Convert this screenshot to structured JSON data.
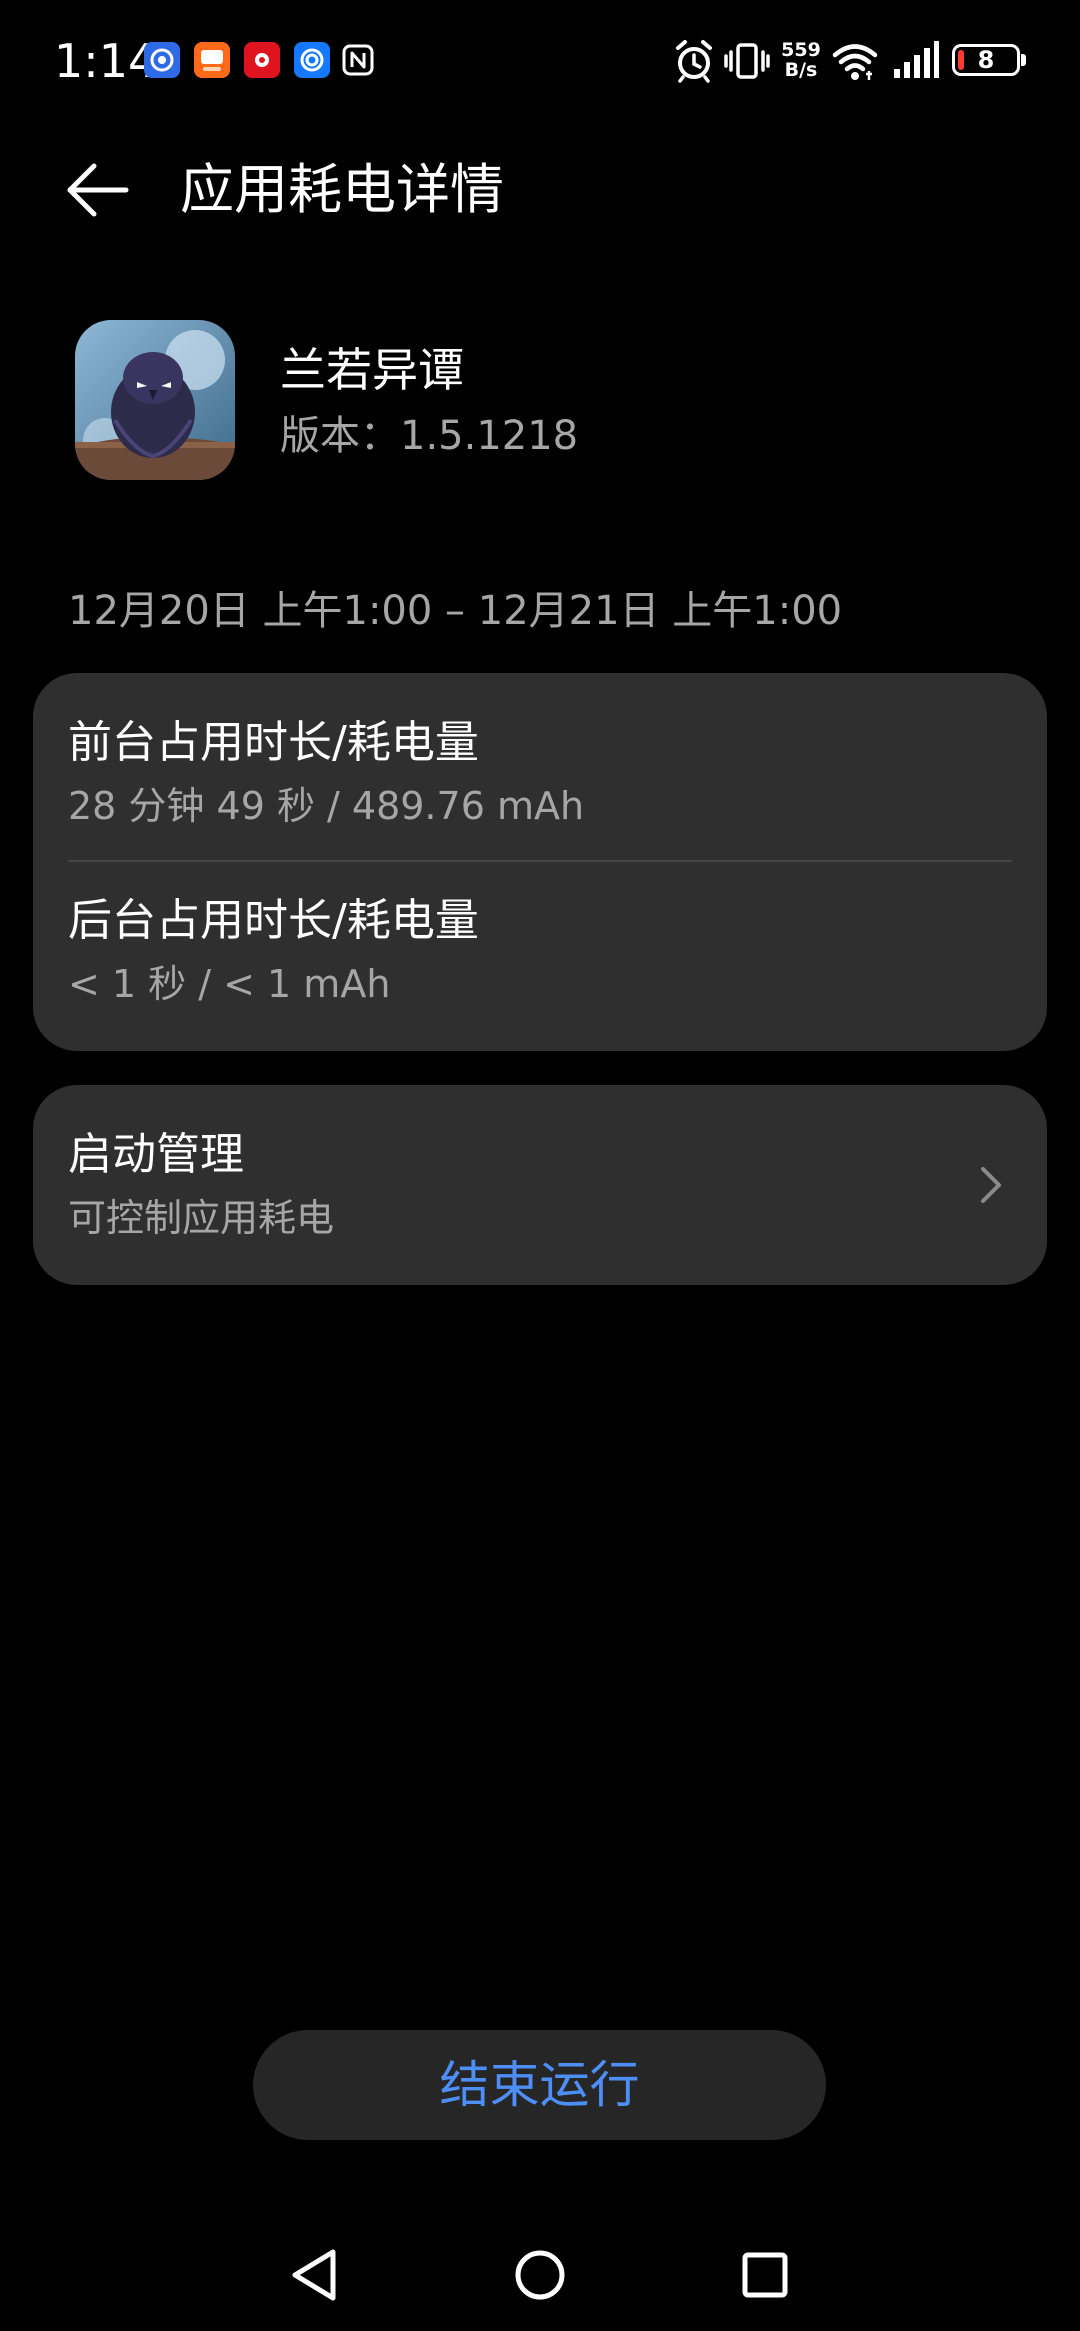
{
  "status_bar": {
    "time": "1:14",
    "network_speed_value": "559",
    "network_speed_unit": "B/s",
    "battery_level": "8",
    "notification_icons": [
      "app-store-icon",
      "taobao-icon",
      "netease-music-icon",
      "browser-icon",
      "nfc-icon"
    ],
    "system_icons": [
      "alarm-icon",
      "vibrate-icon",
      "wifi-icon",
      "cellular-signal-icon",
      "battery-icon"
    ]
  },
  "header": {
    "title": "应用耗电详情"
  },
  "app": {
    "name": "兰若异谭",
    "version_label": "版本：",
    "version_value": "1.5.1218"
  },
  "date_range": "12月20日 上午1:00 – 12月21日 上午1:00",
  "usage": {
    "foreground_title": "前台占用时长/耗电量",
    "foreground_value": "28 分钟 49 秒 / 489.76 mAh",
    "background_title": "后台占用时长/耗电量",
    "background_value": "< 1 秒 / < 1 mAh"
  },
  "launch": {
    "title": "启动管理",
    "subtitle": "可控制应用耗电"
  },
  "actions": {
    "stop_label": "结束运行"
  },
  "colors": {
    "background": "#000000",
    "card": "#2f2f2f",
    "secondary_text": "#a6a6a6",
    "accent": "#4d8ef7",
    "battery_low": "#ff3b30"
  }
}
